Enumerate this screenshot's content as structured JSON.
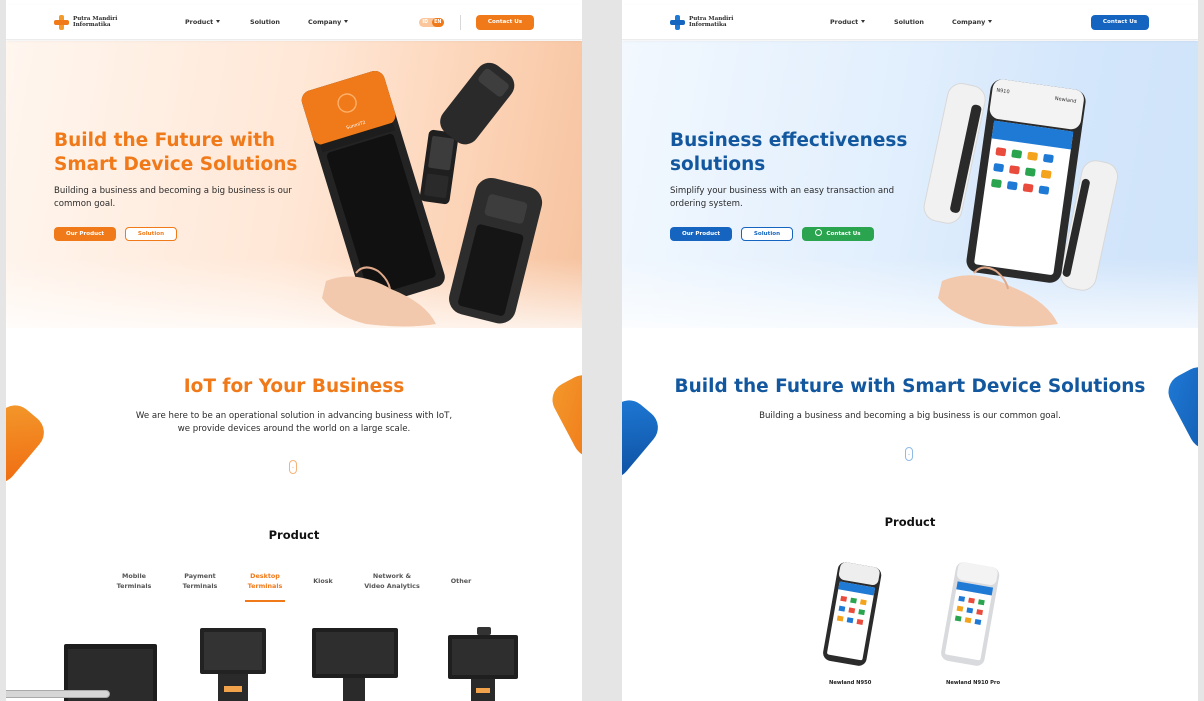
{
  "colors": {
    "orange": "#f07a1a",
    "blue": "#1565c0",
    "green": "#2aa44f",
    "background": "#e5e5e5"
  },
  "left": {
    "header": {
      "logo_line1": "Putra Mandiri",
      "logo_line2": "Informatika",
      "nav": {
        "product": "Product",
        "solution": "Solution",
        "company": "Company"
      },
      "lang_id": "ID",
      "lang_en": "EN",
      "contact": "Contact Us"
    },
    "hero": {
      "title_line1": "Build the Future with",
      "title_line2": "Smart Device Solutions",
      "subtitle": "Building a business and becoming a big business is our common goal.",
      "btn_product": "Our Product",
      "btn_solution": "Solution",
      "device_brand": "SunmiT2"
    },
    "iot": {
      "title": "IoT for Your Business",
      "line1": "We are here to be an operational solution in advancing business with IoT,",
      "line2": "we provide devices around the world on a large scale."
    },
    "product": {
      "title": "Product",
      "tabs": [
        {
          "line1": "Mobile",
          "line2": "Terminals"
        },
        {
          "line1": "Payment",
          "line2": "Terminals"
        },
        {
          "line1": "Desktop",
          "line2": "Terminals"
        },
        {
          "line1": "Kiosk",
          "line2": ""
        },
        {
          "line1": "Network &",
          "line2": "Video Analytics"
        },
        {
          "line1": "Other",
          "line2": ""
        }
      ],
      "active_tab": "Desktop Terminals"
    }
  },
  "right": {
    "header": {
      "logo_line1": "Putra Mandiri",
      "logo_line2": "Informatika",
      "nav": {
        "product": "Product",
        "solution": "Solution",
        "company": "Company"
      },
      "contact": "Contact Us"
    },
    "hero": {
      "title_line1": "Business effectiveness",
      "title_line2": "solutions",
      "subtitle": "Simplify your business with an easy transaction and ordering system.",
      "btn_product": "Our Product",
      "btn_solution": "Solution",
      "btn_contact": "Contact Us",
      "device_model": "N910",
      "device_brand": "Newland"
    },
    "section": {
      "title": "Build the Future with Smart Device Solutions",
      "subtitle": "Building a business and becoming a big business is our common goal."
    },
    "product": {
      "title": "Product",
      "items": [
        {
          "name": "Newland N950"
        },
        {
          "name": "Newland N910 Pro"
        }
      ]
    }
  }
}
